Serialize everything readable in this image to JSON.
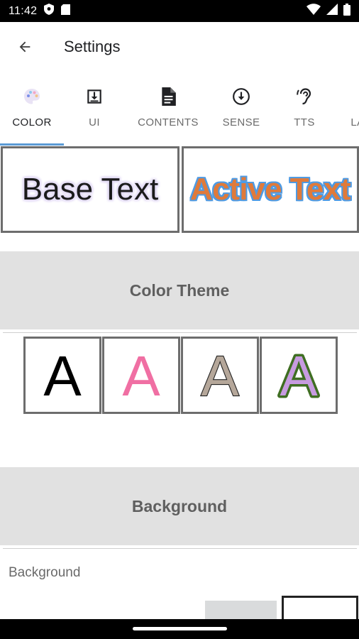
{
  "status_bar": {
    "time": "11:42"
  },
  "app_bar": {
    "title": "Settings"
  },
  "tabs": [
    {
      "label": "COLOR",
      "icon": "palette-icon",
      "active": true
    },
    {
      "label": "UI",
      "icon": "download-box-icon",
      "active": false
    },
    {
      "label": "CONTENTS",
      "icon": "document-icon",
      "active": false
    },
    {
      "label": "SENSE",
      "icon": "arrow-down-circle-icon",
      "active": false
    },
    {
      "label": "TTS",
      "icon": "hearing-icon",
      "active": false
    },
    {
      "label": "LA",
      "icon": "",
      "active": false
    }
  ],
  "preview": {
    "base_text": "Base Text",
    "active_text": "Active Text"
  },
  "sections": {
    "color_theme": "Color Theme",
    "background": "Background"
  },
  "themes": [
    {
      "letter": "A",
      "fill": "#000000",
      "outline": "none"
    },
    {
      "letter": "A",
      "fill": "#f06fa3",
      "outline": "none"
    },
    {
      "letter": "A",
      "fill": "#b5a79a",
      "outline": "#222222"
    },
    {
      "letter": "A",
      "fill": "#c79be0",
      "outline": "#3f6e22"
    }
  ],
  "background_label": "Background",
  "colors": {
    "tab_indicator": "#5b9bd5",
    "active_text_fill": "#e07a3a",
    "active_text_outline": "#4f9be3",
    "base_text_glow": "#e4dcf5",
    "section_bg": "#e1e1e1"
  }
}
